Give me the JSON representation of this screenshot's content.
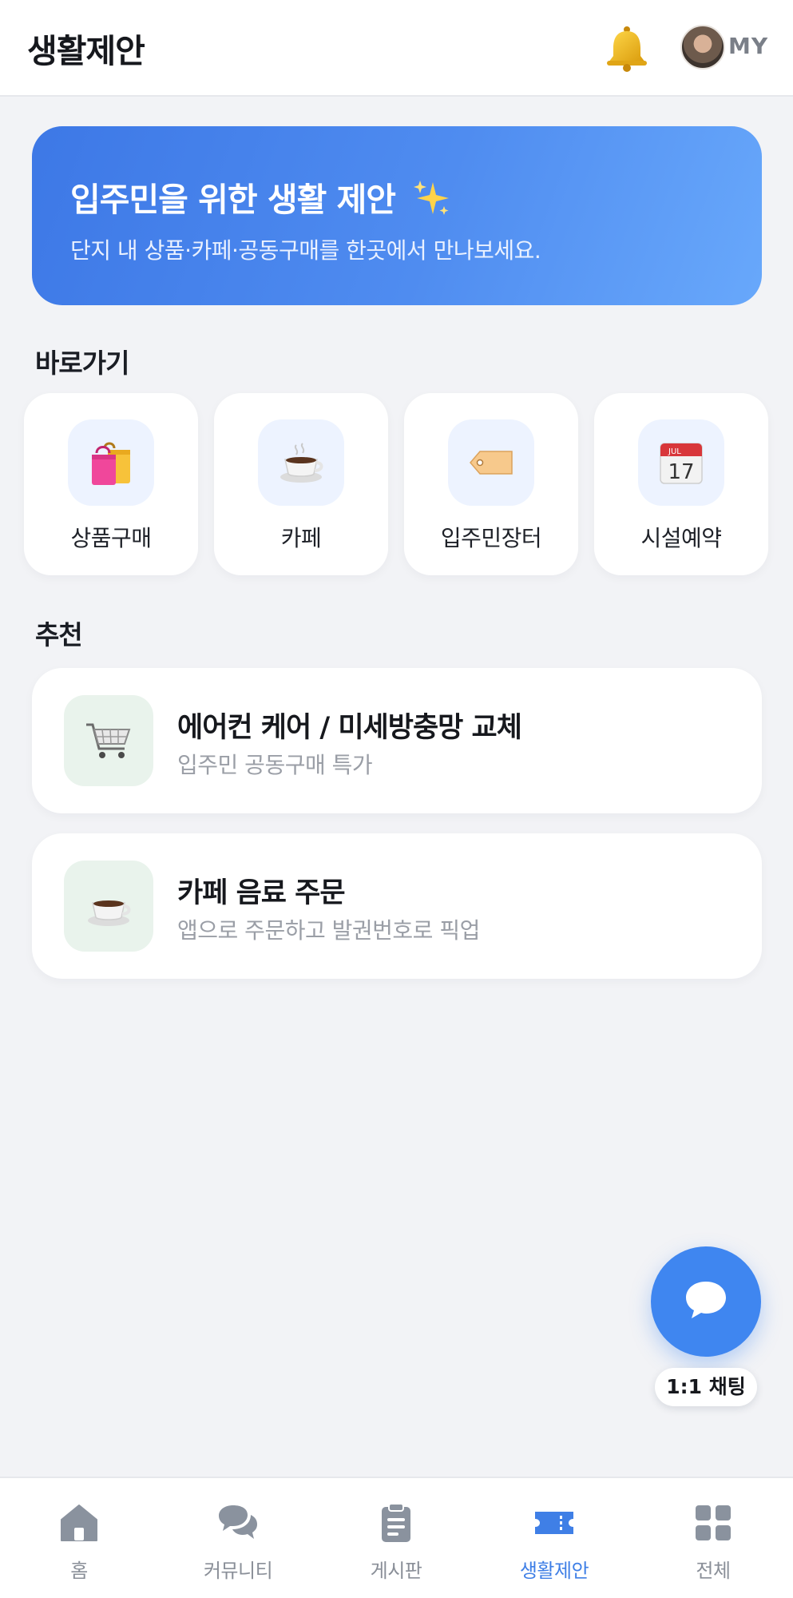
{
  "header": {
    "title": "생활제안",
    "profile_label": "MY"
  },
  "banner": {
    "title": "입주민을 위한 생활 제안",
    "subtitle": "단지 내 상품·카페·공동구매를 한곳에서 만나보세요."
  },
  "shortcuts": {
    "title": "바로가기",
    "items": [
      {
        "label": "상품구매",
        "icon": "shopping-bags-icon"
      },
      {
        "label": "카페",
        "icon": "coffee-cup-icon"
      },
      {
        "label": "입주민장터",
        "icon": "price-tag-icon"
      },
      {
        "label": "시설예약",
        "icon": "calendar-icon",
        "calendar_month": "JUL",
        "calendar_day": "17"
      }
    ]
  },
  "recommendations": {
    "title": "추천",
    "items": [
      {
        "title": "에어컨 케어 / 미세방충망 교체",
        "subtitle": "입주민 공동구매 특가",
        "icon": "shopping-cart-icon"
      },
      {
        "title": "카페 음료 주문",
        "subtitle": "앱으로 주문하고 발권번호로 픽업",
        "icon": "coffee-cup-icon"
      }
    ]
  },
  "chat_fab": {
    "label": "1:1 채팅"
  },
  "bottom_nav": {
    "items": [
      {
        "label": "홈",
        "icon": "home-icon",
        "active": false
      },
      {
        "label": "커뮤니티",
        "icon": "chat-bubbles-icon",
        "active": false
      },
      {
        "label": "게시판",
        "icon": "clipboard-icon",
        "active": false
      },
      {
        "label": "생활제안",
        "icon": "ticket-icon",
        "active": true
      },
      {
        "label": "전체",
        "icon": "grid-icon",
        "active": false
      }
    ]
  },
  "colors": {
    "accent": "#3f86f0",
    "active_nav": "#3f7fe6",
    "background": "#f2f3f6"
  }
}
